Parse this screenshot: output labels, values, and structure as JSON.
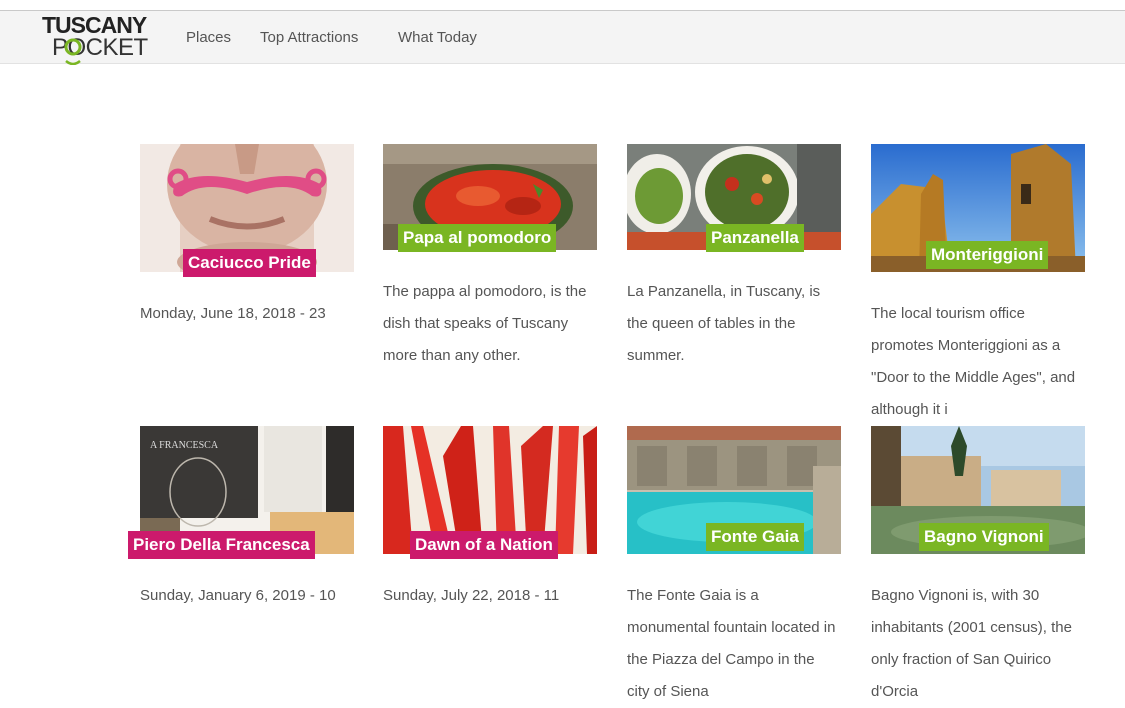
{
  "nav": {
    "logo_line1": "TUSCANY",
    "logo_line2": "POCKET",
    "links": [
      "Places",
      "Top Attractions",
      "What Today"
    ]
  },
  "colors": {
    "pink_tag": "#cc1a6c",
    "green_tag": "#7ab623",
    "text": "#555555",
    "navbar": "#f4f4f4"
  },
  "cards": [
    {
      "title": "Caciucco Pride",
      "tag_color": "pink",
      "text": "Monday, June 18, 2018 - 23"
    },
    {
      "title": "Papa al pomodoro",
      "tag_color": "green",
      "text": "The pappa al pomodoro, is the dish that speaks of Tuscany more than any other."
    },
    {
      "title": "Panzanella",
      "tag_color": "green",
      "text": "La Panzanella, in Tuscany, is the queen of tables in the summer."
    },
    {
      "title": "Monteriggioni",
      "tag_color": "green",
      "text": "The local tourism office promotes Monteriggioni as a \"Door to the Middle Ages\", and although it i"
    },
    {
      "title": "Piero Della Francesca",
      "tag_color": "pink",
      "text": "Sunday, January 6, 2019 - 10"
    },
    {
      "title": "Dawn of a Nation",
      "tag_color": "pink",
      "text": "Sunday, July 22, 2018 - 11"
    },
    {
      "title": "Fonte Gaia",
      "tag_color": "green",
      "text": "The Fonte Gaia is a monumental fountain located in the Piazza del Campo in the city of Siena"
    },
    {
      "title": "Bagno Vignoni",
      "tag_color": "green",
      "text": "Bagno Vignoni is, with 30 inhabitants (2001 census), the only fraction of San Quirico d'Orcia"
    }
  ]
}
